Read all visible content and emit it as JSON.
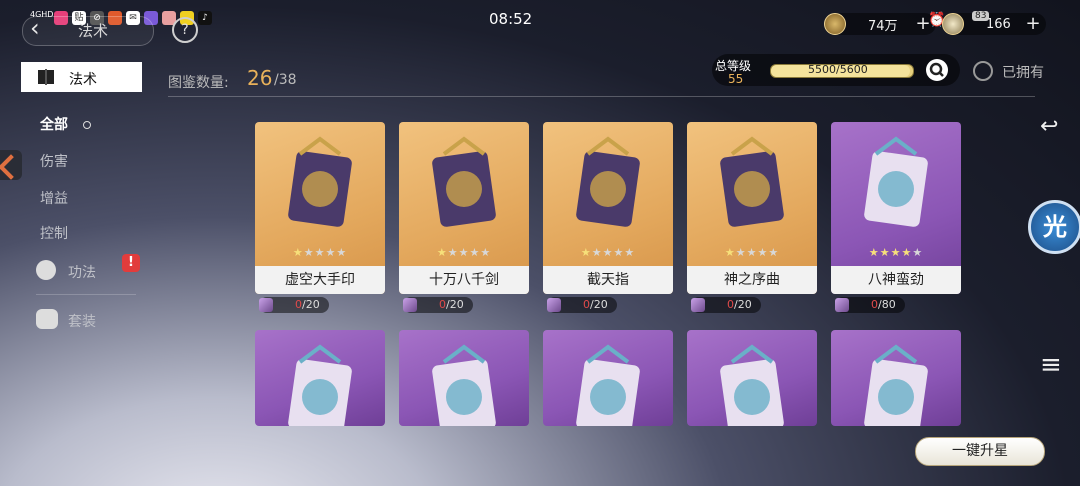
{
  "status_bar": {
    "time": "08:52",
    "signal": "4GHD",
    "app_icons": [
      "weibo-icon",
      "tieba-icon",
      "link-icon",
      "game-icon",
      "mail-icon",
      "app-icon",
      "anime-icon",
      "app2-icon",
      "tiktok-icon"
    ]
  },
  "header": {
    "title": "法术",
    "help": "?",
    "currency1_value": "74万",
    "currency2_value": "166",
    "currency2_badge": "83"
  },
  "sidebar": {
    "active_tab": "法术",
    "items": [
      {
        "label": "全部"
      },
      {
        "label": "伤害"
      },
      {
        "label": "增益"
      },
      {
        "label": "控制"
      },
      {
        "label": "功法"
      },
      {
        "label": "套装"
      }
    ],
    "badge": "!"
  },
  "collection": {
    "label": "图鉴数量:",
    "current": "26",
    "total": "/38"
  },
  "level": {
    "label": "总等级",
    "value": "55",
    "progress_text": "5500/5600",
    "progress_fraction": 0.982
  },
  "filter": {
    "owned_label": "已拥有"
  },
  "cards_row1": [
    {
      "name": "虚空大手印",
      "stars_filled": 1,
      "fragments": "0",
      "fragments_total": "/20",
      "color": "gold"
    },
    {
      "name": "十万八千剑",
      "stars_filled": 1,
      "fragments": "0",
      "fragments_total": "/20",
      "color": "gold"
    },
    {
      "name": "截天指",
      "stars_filled": 1,
      "fragments": "0",
      "fragments_total": "/20",
      "color": "gold"
    },
    {
      "name": "神之序曲",
      "stars_filled": 1,
      "fragments": "0",
      "fragments_total": "/20",
      "color": "gold"
    },
    {
      "name": "八神蛮劲",
      "stars_filled": 4,
      "fragments": "0",
      "fragments_total": "/80",
      "color": "purple"
    }
  ],
  "cards_row2": [
    {
      "color": "purple"
    },
    {
      "color": "purple"
    },
    {
      "color": "purple"
    },
    {
      "color": "purple"
    },
    {
      "color": "purple"
    }
  ],
  "right_panel": {
    "avatar_char": "光",
    "one_key_upstar": "一键升星"
  },
  "colors": {
    "gold_card": "#e3a85d",
    "purple_card": "#8b56b5",
    "accent": "#e8b15a",
    "fragment_red": "#e04a4a"
  }
}
